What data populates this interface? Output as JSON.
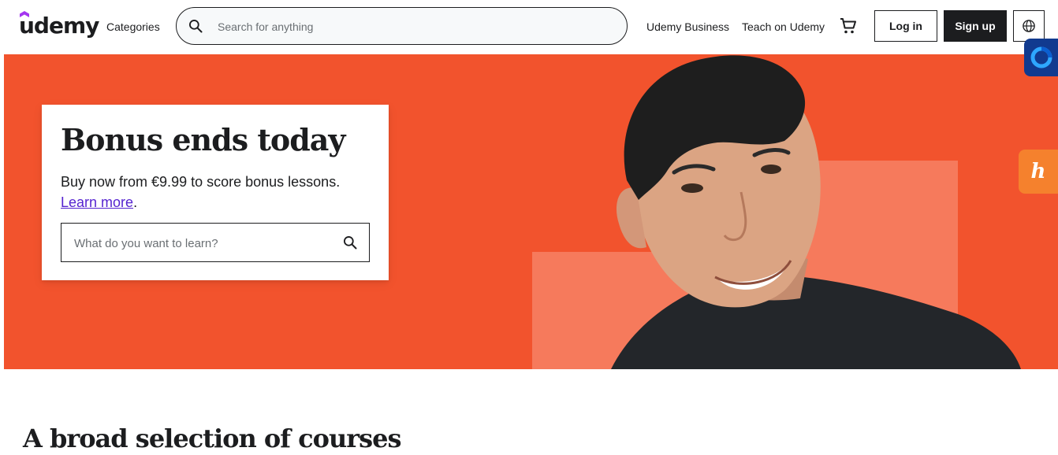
{
  "header": {
    "logo_text": "udemy",
    "categories_label": "Categories",
    "search_placeholder": "Search for anything",
    "udemy_business_label": "Udemy Business",
    "teach_label": "Teach on Udemy",
    "login_label": "Log in",
    "signup_label": "Sign up",
    "icons": [
      "search-icon",
      "cart-icon",
      "globe-icon"
    ]
  },
  "extensions": {
    "honey_label": "h"
  },
  "hero": {
    "title": "Bonus ends today",
    "text": "Buy now from €9.99 to score bonus lessons.",
    "link_label": "Learn more",
    "link_suffix": ".",
    "search_placeholder": "What do you want to learn?"
  },
  "section": {
    "title": "A broad selection of courses"
  },
  "colors": {
    "brand_orange": "#f2532d",
    "deco_salmon": "#f67a5c",
    "brand_purple": "#a435f0",
    "link_purple": "#5624d0",
    "dark": "#1c1d1f"
  }
}
